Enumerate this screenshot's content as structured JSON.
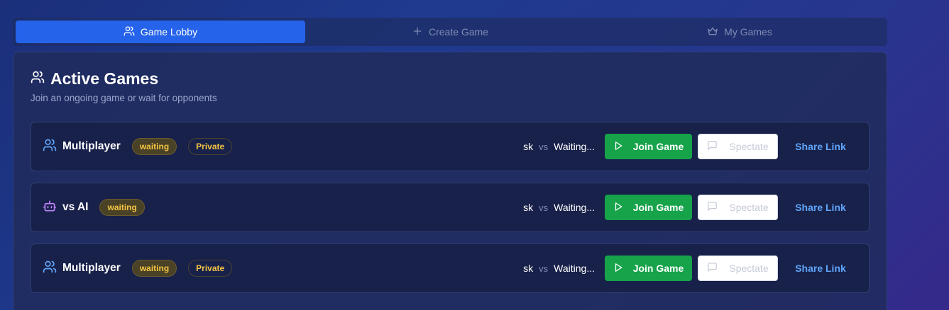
{
  "tabs": [
    {
      "label": "Game Lobby",
      "icon": "users-icon",
      "active": true
    },
    {
      "label": "Create Game",
      "icon": "plus-icon",
      "active": false
    },
    {
      "label": "My Games",
      "icon": "crown-icon",
      "active": false
    }
  ],
  "panel": {
    "title": "Active Games",
    "subtitle": "Join an ongoing game or wait for opponents"
  },
  "games": [
    {
      "mode": "Multiplayer",
      "icon": "users-icon",
      "status": "waiting",
      "private_label": "Private",
      "player1": "sk",
      "vs": "vs",
      "player2": "Waiting...",
      "join_label": "Join Game",
      "spectate_label": "Spectate",
      "share_label": "Share Link"
    },
    {
      "mode": "vs AI",
      "icon": "bot-icon",
      "status": "waiting",
      "private_label": "",
      "player1": "sk",
      "vs": "vs",
      "player2": "Waiting...",
      "join_label": "Join Game",
      "spectate_label": "Spectate",
      "share_label": "Share Link"
    },
    {
      "mode": "Multiplayer",
      "icon": "users-icon",
      "status": "waiting",
      "private_label": "Private",
      "player1": "sk",
      "vs": "vs",
      "player2": "Waiting...",
      "join_label": "Join Game",
      "spectate_label": "Spectate",
      "share_label": "Share Link"
    }
  ],
  "colors": {
    "accent": "#2563eb",
    "join": "#16a34a",
    "badge_text": "#f5c542",
    "link": "#60a5fa",
    "ai_icon": "#c084fc",
    "user_icon": "#60a5fa"
  }
}
